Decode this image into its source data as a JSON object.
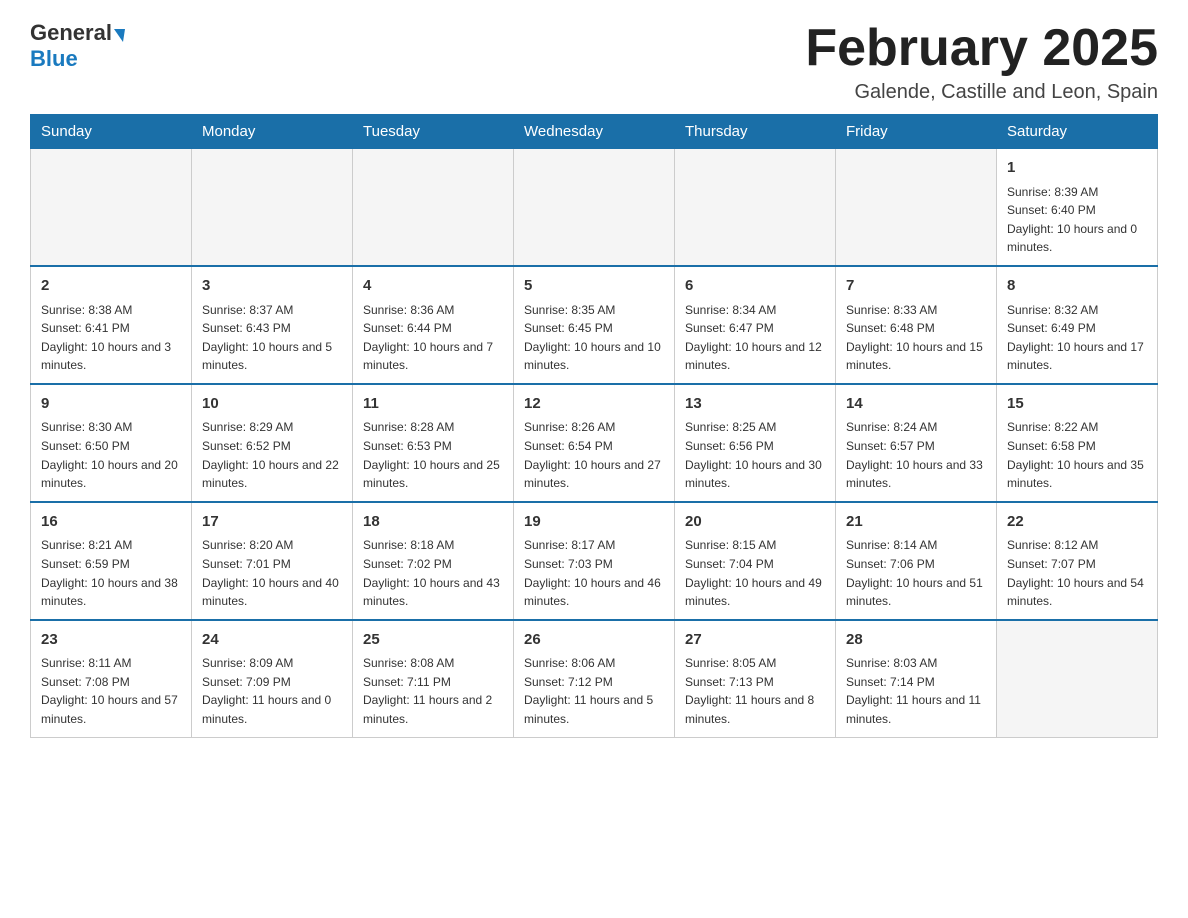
{
  "header": {
    "logo": {
      "general": "General",
      "blue": "Blue"
    },
    "title": "February 2025",
    "location": "Galende, Castille and Leon, Spain"
  },
  "weekdays": [
    "Sunday",
    "Monday",
    "Tuesday",
    "Wednesday",
    "Thursday",
    "Friday",
    "Saturday"
  ],
  "weeks": [
    [
      {
        "day": "",
        "empty": true
      },
      {
        "day": "",
        "empty": true
      },
      {
        "day": "",
        "empty": true
      },
      {
        "day": "",
        "empty": true
      },
      {
        "day": "",
        "empty": true
      },
      {
        "day": "",
        "empty": true
      },
      {
        "day": "1",
        "sunrise": "8:39 AM",
        "sunset": "6:40 PM",
        "daylight": "10 hours and 0 minutes."
      }
    ],
    [
      {
        "day": "2",
        "sunrise": "8:38 AM",
        "sunset": "6:41 PM",
        "daylight": "10 hours and 3 minutes."
      },
      {
        "day": "3",
        "sunrise": "8:37 AM",
        "sunset": "6:43 PM",
        "daylight": "10 hours and 5 minutes."
      },
      {
        "day": "4",
        "sunrise": "8:36 AM",
        "sunset": "6:44 PM",
        "daylight": "10 hours and 7 minutes."
      },
      {
        "day": "5",
        "sunrise": "8:35 AM",
        "sunset": "6:45 PM",
        "daylight": "10 hours and 10 minutes."
      },
      {
        "day": "6",
        "sunrise": "8:34 AM",
        "sunset": "6:47 PM",
        "daylight": "10 hours and 12 minutes."
      },
      {
        "day": "7",
        "sunrise": "8:33 AM",
        "sunset": "6:48 PM",
        "daylight": "10 hours and 15 minutes."
      },
      {
        "day": "8",
        "sunrise": "8:32 AM",
        "sunset": "6:49 PM",
        "daylight": "10 hours and 17 minutes."
      }
    ],
    [
      {
        "day": "9",
        "sunrise": "8:30 AM",
        "sunset": "6:50 PM",
        "daylight": "10 hours and 20 minutes."
      },
      {
        "day": "10",
        "sunrise": "8:29 AM",
        "sunset": "6:52 PM",
        "daylight": "10 hours and 22 minutes."
      },
      {
        "day": "11",
        "sunrise": "8:28 AM",
        "sunset": "6:53 PM",
        "daylight": "10 hours and 25 minutes."
      },
      {
        "day": "12",
        "sunrise": "8:26 AM",
        "sunset": "6:54 PM",
        "daylight": "10 hours and 27 minutes."
      },
      {
        "day": "13",
        "sunrise": "8:25 AM",
        "sunset": "6:56 PM",
        "daylight": "10 hours and 30 minutes."
      },
      {
        "day": "14",
        "sunrise": "8:24 AM",
        "sunset": "6:57 PM",
        "daylight": "10 hours and 33 minutes."
      },
      {
        "day": "15",
        "sunrise": "8:22 AM",
        "sunset": "6:58 PM",
        "daylight": "10 hours and 35 minutes."
      }
    ],
    [
      {
        "day": "16",
        "sunrise": "8:21 AM",
        "sunset": "6:59 PM",
        "daylight": "10 hours and 38 minutes."
      },
      {
        "day": "17",
        "sunrise": "8:20 AM",
        "sunset": "7:01 PM",
        "daylight": "10 hours and 40 minutes."
      },
      {
        "day": "18",
        "sunrise": "8:18 AM",
        "sunset": "7:02 PM",
        "daylight": "10 hours and 43 minutes."
      },
      {
        "day": "19",
        "sunrise": "8:17 AM",
        "sunset": "7:03 PM",
        "daylight": "10 hours and 46 minutes."
      },
      {
        "day": "20",
        "sunrise": "8:15 AM",
        "sunset": "7:04 PM",
        "daylight": "10 hours and 49 minutes."
      },
      {
        "day": "21",
        "sunrise": "8:14 AM",
        "sunset": "7:06 PM",
        "daylight": "10 hours and 51 minutes."
      },
      {
        "day": "22",
        "sunrise": "8:12 AM",
        "sunset": "7:07 PM",
        "daylight": "10 hours and 54 minutes."
      }
    ],
    [
      {
        "day": "23",
        "sunrise": "8:11 AM",
        "sunset": "7:08 PM",
        "daylight": "10 hours and 57 minutes."
      },
      {
        "day": "24",
        "sunrise": "8:09 AM",
        "sunset": "7:09 PM",
        "daylight": "11 hours and 0 minutes."
      },
      {
        "day": "25",
        "sunrise": "8:08 AM",
        "sunset": "7:11 PM",
        "daylight": "11 hours and 2 minutes."
      },
      {
        "day": "26",
        "sunrise": "8:06 AM",
        "sunset": "7:12 PM",
        "daylight": "11 hours and 5 minutes."
      },
      {
        "day": "27",
        "sunrise": "8:05 AM",
        "sunset": "7:13 PM",
        "daylight": "11 hours and 8 minutes."
      },
      {
        "day": "28",
        "sunrise": "8:03 AM",
        "sunset": "7:14 PM",
        "daylight": "11 hours and 11 minutes."
      },
      {
        "day": "",
        "empty": true
      }
    ]
  ]
}
